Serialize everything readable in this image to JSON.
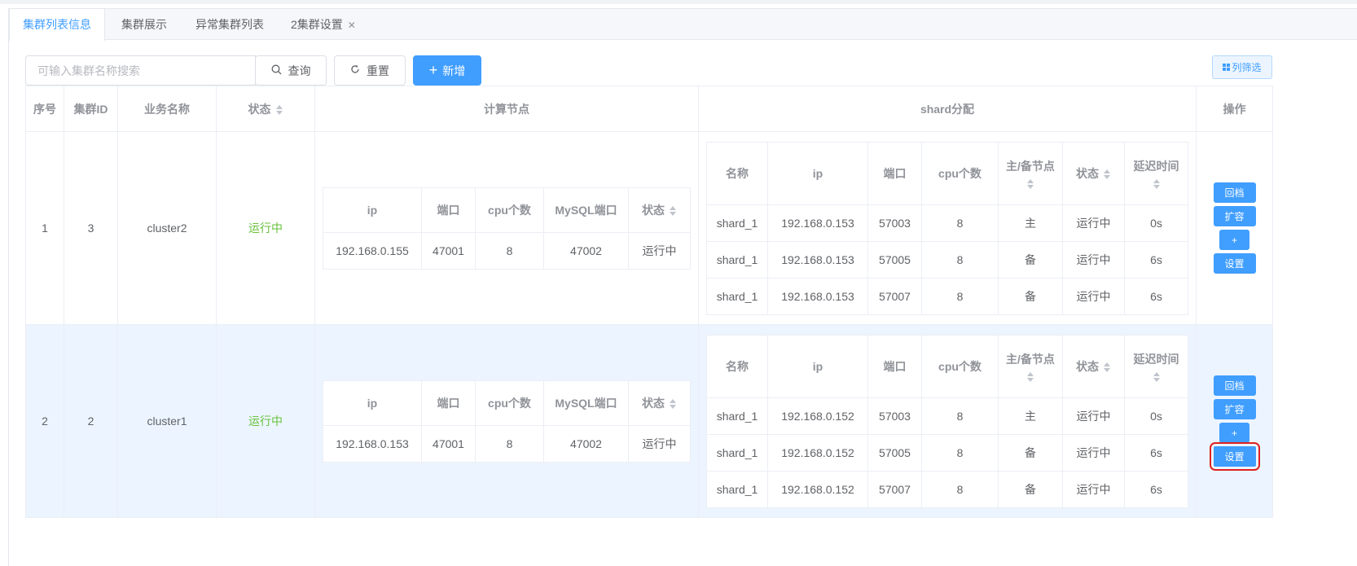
{
  "tabs": [
    {
      "label": "集群列表信息",
      "active": true
    },
    {
      "label": "集群展示",
      "active": false
    },
    {
      "label": "异常集群列表",
      "active": false
    },
    {
      "label": "2集群设置",
      "active": false,
      "closable": true
    }
  ],
  "toolbar": {
    "search_placeholder": "可输入集群名称搜索",
    "query_label": "查询",
    "reset_label": "重置",
    "add_label": "新增",
    "column_filter_label": "列筛选"
  },
  "table": {
    "headers": {
      "index": "序号",
      "cluster_id": "集群ID",
      "business_name": "业务名称",
      "status": "状态",
      "compute_nodes": "计算节点",
      "shard": "shard分配",
      "ops": "操作"
    },
    "compute_headers": {
      "ip": "ip",
      "port": "端口",
      "cpu": "cpu个数",
      "mysql_port": "MySQL端口",
      "status": "状态"
    },
    "shard_headers": {
      "name": "名称",
      "ip": "ip",
      "port": "端口",
      "cpu": "cpu个数",
      "role": "主/备节点",
      "status": "状态",
      "delay": "延迟时间"
    },
    "op_labels": {
      "archive": "回档",
      "expand": "扩容",
      "plus": "+",
      "settings": "设置"
    },
    "rows": [
      {
        "index": "1",
        "cluster_id": "3",
        "business_name": "cluster2",
        "status": "运行中",
        "compute": {
          "ip": "192.168.0.155",
          "port": "47001",
          "cpu": "8",
          "mysql_port": "47002",
          "status": "运行中"
        },
        "shards": [
          {
            "name": "shard_1",
            "ip": "192.168.0.153",
            "port": "57003",
            "cpu": "8",
            "role": "主",
            "status": "运行中",
            "delay": "0s"
          },
          {
            "name": "shard_1",
            "ip": "192.168.0.153",
            "port": "57005",
            "cpu": "8",
            "role": "备",
            "status": "运行中",
            "delay": "6s"
          },
          {
            "name": "shard_1",
            "ip": "192.168.0.153",
            "port": "57007",
            "cpu": "8",
            "role": "备",
            "status": "运行中",
            "delay": "6s"
          }
        ]
      },
      {
        "index": "2",
        "cluster_id": "2",
        "business_name": "cluster1",
        "status": "运行中",
        "compute": {
          "ip": "192.168.0.153",
          "port": "47001",
          "cpu": "8",
          "mysql_port": "47002",
          "status": "运行中"
        },
        "shards": [
          {
            "name": "shard_1",
            "ip": "192.168.0.152",
            "port": "57003",
            "cpu": "8",
            "role": "主",
            "status": "运行中",
            "delay": "0s"
          },
          {
            "name": "shard_1",
            "ip": "192.168.0.152",
            "port": "57005",
            "cpu": "8",
            "role": "备",
            "status": "运行中",
            "delay": "6s"
          },
          {
            "name": "shard_1",
            "ip": "192.168.0.152",
            "port": "57007",
            "cpu": "8",
            "role": "备",
            "status": "运行中",
            "delay": "6s"
          }
        ]
      }
    ]
  },
  "colors": {
    "primary": "#409eff",
    "success": "#67c23a",
    "highlight": "#e02020"
  }
}
